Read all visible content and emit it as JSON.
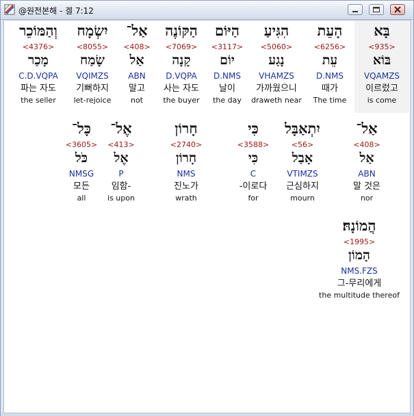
{
  "window": {
    "title": "@원전본해 - 겔 7:12",
    "buttons": {
      "minimize": "minimize-icon",
      "maximize": "maximize-icon",
      "close": "close-icon"
    }
  },
  "words": [
    {
      "heb": "בָּא",
      "strong": "<935>",
      "lemma": "בּוֹא",
      "morph": "VQAMZS",
      "kor": "이르렀고",
      "eng": "is come"
    },
    {
      "heb": "הָעֵת",
      "strong": "<6256>",
      "lemma": "עֵת",
      "morph": "D.NMS",
      "kor": "때가",
      "eng": "The time"
    },
    {
      "heb": "הִגִּיעַ",
      "strong": "<5060>",
      "lemma": "נָגַע",
      "morph": "VHAMZS",
      "kor": "가까웠으니",
      "eng": "draweth near"
    },
    {
      "heb": "הַיּוֹם",
      "strong": "<3117>",
      "lemma": "יוֹם",
      "morph": "D.NMS",
      "kor": "날이",
      "eng": "the day"
    },
    {
      "heb": "הַקּוֹנֶה",
      "strong": "<7069>",
      "lemma": "קָנָה",
      "morph": "D.VQPA",
      "kor": "사는 자도",
      "eng": "the buyer"
    },
    {
      "heb": "אַל־",
      "strong": "<408>",
      "lemma": "אַל",
      "morph": "ABN",
      "kor": "말고",
      "eng": "not"
    },
    {
      "heb": "יִשְׂמָח",
      "strong": "<8055>",
      "lemma": "שָׂמַח",
      "morph": "VQIMZS",
      "kor": "기뻐하지",
      "eng": "let-rejoice"
    },
    {
      "heb": "וְהַמּוֹכֵר",
      "strong": "<4376>",
      "lemma": "מָכַר",
      "morph": "C.D.VQPA",
      "kor": "파는 자도",
      "eng": "the seller"
    },
    {
      "heb": "אַל־",
      "strong": "<408>",
      "lemma": "אַל",
      "morph": "ABN",
      "kor": "말 것은",
      "eng": "nor"
    },
    {
      "heb": "יִתְאַבָּל",
      "strong": "<56>",
      "lemma": "אָבַל",
      "morph": "VTIMZS",
      "kor": "근심하지",
      "eng": "mourn"
    },
    {
      "heb": "כִּי",
      "strong": "<3588>",
      "lemma": "כִּי",
      "morph": "C",
      "kor": "-이로다",
      "eng": "for"
    },
    {
      "heb": "חָרוֹן",
      "strong": "<2740>",
      "lemma": "חָרוֹן",
      "morph": "NMS",
      "kor": "진노가",
      "eng": "wrath"
    },
    {
      "heb": "אֶל־",
      "strong": "<413>",
      "lemma": "אֶל",
      "morph": "P",
      "kor": "임함-",
      "eng": "is upon"
    },
    {
      "heb": "כָּל־",
      "strong": "<3605>",
      "lemma": "כֹּל",
      "morph": "NMSG",
      "kor": "모든",
      "eng": "all"
    },
    {
      "heb": "הֲמוֹנָהּ׃",
      "strong": "<1995>",
      "lemma": "הָמוֹן",
      "morph": "NMS.FZS",
      "kor": "그-무리에게",
      "eng": "the multitude thereof"
    }
  ]
}
